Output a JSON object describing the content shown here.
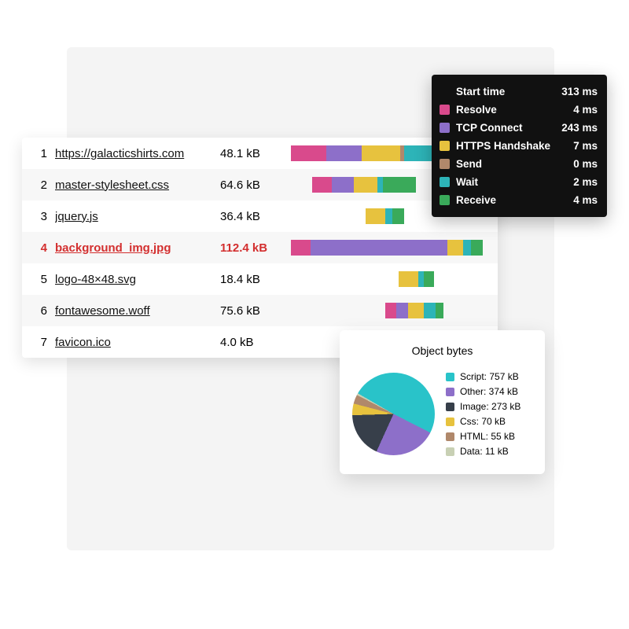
{
  "colors": {
    "resolve": "#d94a8c",
    "tcp": "#8d6fc9",
    "https": "#e7c23e",
    "send": "#b0886b",
    "wait": "#2db4b8",
    "receive": "#3aaa5a",
    "script": "#29c3c9",
    "other": "#8d6fc9",
    "image": "#373f4a",
    "css": "#e7c23e",
    "html": "#b0886b",
    "data": "#c8d0b4"
  },
  "tooltip": {
    "rows": [
      {
        "label": "Start time",
        "value": "313 ms",
        "color": null
      },
      {
        "label": "Resolve",
        "value": "4 ms",
        "color": "resolve"
      },
      {
        "label": "TCP Connect",
        "value": "243 ms",
        "color": "tcp"
      },
      {
        "label": "HTTPS Handshake",
        "value": "7 ms",
        "color": "https"
      },
      {
        "label": "Send",
        "value": "0 ms",
        "color": "send"
      },
      {
        "label": "Wait",
        "value": "2 ms",
        "color": "wait"
      },
      {
        "label": "Receive",
        "value": "4 ms",
        "color": "receive"
      }
    ]
  },
  "waterfall": {
    "rows": [
      {
        "idx": "1",
        "name": "https://galacticshirts.com",
        "size": "48.1 kB",
        "highlight": false,
        "segments": [
          {
            "color": "resolve",
            "start": 0,
            "width": 18
          },
          {
            "color": "tcp",
            "start": 18,
            "width": 18
          },
          {
            "color": "https",
            "start": 36,
            "width": 20
          },
          {
            "color": "send",
            "start": 56,
            "width": 2
          },
          {
            "color": "wait",
            "start": 58,
            "width": 17
          },
          {
            "color": "receive",
            "start": 75,
            "width": 15
          }
        ]
      },
      {
        "idx": "2",
        "name": "master-stylesheet.css",
        "size": "64.6 kB",
        "highlight": false,
        "segments": [
          {
            "color": "resolve",
            "start": 11,
            "width": 10
          },
          {
            "color": "tcp",
            "start": 21,
            "width": 11
          },
          {
            "color": "https",
            "start": 32,
            "width": 12
          },
          {
            "color": "wait",
            "start": 44,
            "width": 3
          },
          {
            "color": "receive",
            "start": 47,
            "width": 17
          }
        ]
      },
      {
        "idx": "3",
        "name": "jquery.js",
        "size": "36.4 kB",
        "highlight": false,
        "segments": [
          {
            "color": "https",
            "start": 38,
            "width": 10
          },
          {
            "color": "wait",
            "start": 48,
            "width": 4
          },
          {
            "color": "receive",
            "start": 52,
            "width": 6
          }
        ]
      },
      {
        "idx": "4",
        "name": "background_img.jpg",
        "size": "112.4 kB",
        "highlight": true,
        "segments": [
          {
            "color": "resolve",
            "start": 0,
            "width": 10
          },
          {
            "color": "tcp",
            "start": 10,
            "width": 70
          },
          {
            "color": "https",
            "start": 80,
            "width": 8
          },
          {
            "color": "wait",
            "start": 88,
            "width": 4
          },
          {
            "color": "receive",
            "start": 92,
            "width": 6
          }
        ]
      },
      {
        "idx": "5",
        "name": "logo-48×48.svg",
        "size": "18.4 kB",
        "highlight": false,
        "segments": [
          {
            "color": "https",
            "start": 55,
            "width": 10
          },
          {
            "color": "wait",
            "start": 65,
            "width": 3
          },
          {
            "color": "receive",
            "start": 68,
            "width": 5
          }
        ]
      },
      {
        "idx": "6",
        "name": "fontawesome.woff",
        "size": "75.6 kB",
        "highlight": false,
        "segments": [
          {
            "color": "resolve",
            "start": 48,
            "width": 6
          },
          {
            "color": "tcp",
            "start": 54,
            "width": 6
          },
          {
            "color": "https",
            "start": 60,
            "width": 8
          },
          {
            "color": "wait",
            "start": 68,
            "width": 6
          },
          {
            "color": "receive",
            "start": 74,
            "width": 4
          }
        ]
      },
      {
        "idx": "7",
        "name": "favicon.ico",
        "size": "4.0 kB",
        "highlight": false,
        "segments": []
      }
    ]
  },
  "pie": {
    "title": "Object bytes",
    "items": [
      {
        "label": "Script: 757 kB",
        "color": "script",
        "value": 757
      },
      {
        "label": "Other: 374 kB",
        "color": "other",
        "value": 374
      },
      {
        "label": "Image: 273 kB",
        "color": "image",
        "value": 273
      },
      {
        "label": "Css: 70 kB",
        "color": "css",
        "value": 70
      },
      {
        "label": "HTML: 55 kB",
        "color": "html",
        "value": 55
      },
      {
        "label": "Data: 11 kB",
        "color": "data",
        "value": 11
      }
    ]
  },
  "chart_data": [
    {
      "type": "table",
      "title": "Network waterfall timing (first row)",
      "categories": [
        "Start time",
        "Resolve",
        "TCP Connect",
        "HTTPS Handshake",
        "Send",
        "Wait",
        "Receive"
      ],
      "values": [
        313,
        4,
        243,
        7,
        0,
        2,
        4
      ],
      "ylabel": "ms"
    },
    {
      "type": "pie",
      "title": "Object bytes",
      "categories": [
        "Script",
        "Other",
        "Image",
        "Css",
        "HTML",
        "Data"
      ],
      "values": [
        757,
        374,
        273,
        70,
        55,
        11
      ],
      "ylabel": "kB"
    }
  ]
}
